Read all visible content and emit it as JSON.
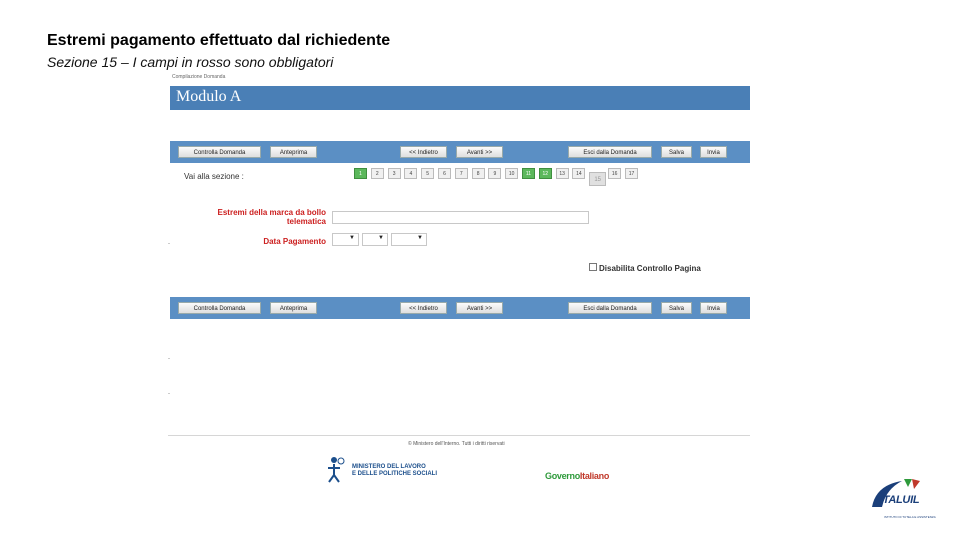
{
  "slide": {
    "title": "Estremi pagamento effettuato dal richiedente",
    "subtitle": "Sezione 15 – I campi in rosso sono obbligatori"
  },
  "app": {
    "breadcrumb": "Compilazione Domanda",
    "module_title": "Modulo A",
    "toolbar": {
      "controlla": "Controlla Domanda",
      "anteprima": "Anteprima",
      "indietro": "<< Indietro",
      "avanti": "Avanti >>",
      "esci": "Esci dalla Domanda",
      "salva": "Salva",
      "invia": "Invia"
    },
    "section_nav": {
      "label": "Vai alla sezione :",
      "items": [
        "1",
        "2",
        "3",
        "4",
        "5",
        "6",
        "7",
        "8",
        "9",
        "10",
        "11",
        "12",
        "13",
        "14",
        "15",
        "16",
        "17"
      ],
      "green_items": [
        "1",
        "11",
        "12"
      ],
      "current": "15"
    },
    "form": {
      "marca_label_line1": "Estremi della marca da bollo",
      "marca_label_line2": "telematica",
      "marca_value": "",
      "data_pagamento_label": "Data Pagamento",
      "disable_label": "Disabilita Controllo Pagina"
    },
    "footer": {
      "copyright": "© Ministero dell'Interno. Tutti i diritti riservati",
      "ministero_line1": "MINISTERO DEL LAVORO",
      "ministero_line2": "E DELLE POLITICHE SOCIALI",
      "governo_part1": "Governo",
      "governo_part2": "Italiano"
    }
  },
  "branding": {
    "italuil": "ITALUIL",
    "italuil_sub": "ISTITUTO DI TUTELA E ASSISTENZA"
  },
  "colors": {
    "header_blue": "#4a7fb6",
    "toolbar_blue": "#5b8fc4",
    "required_red": "#cc2020",
    "section_green": "#5cb85c"
  }
}
